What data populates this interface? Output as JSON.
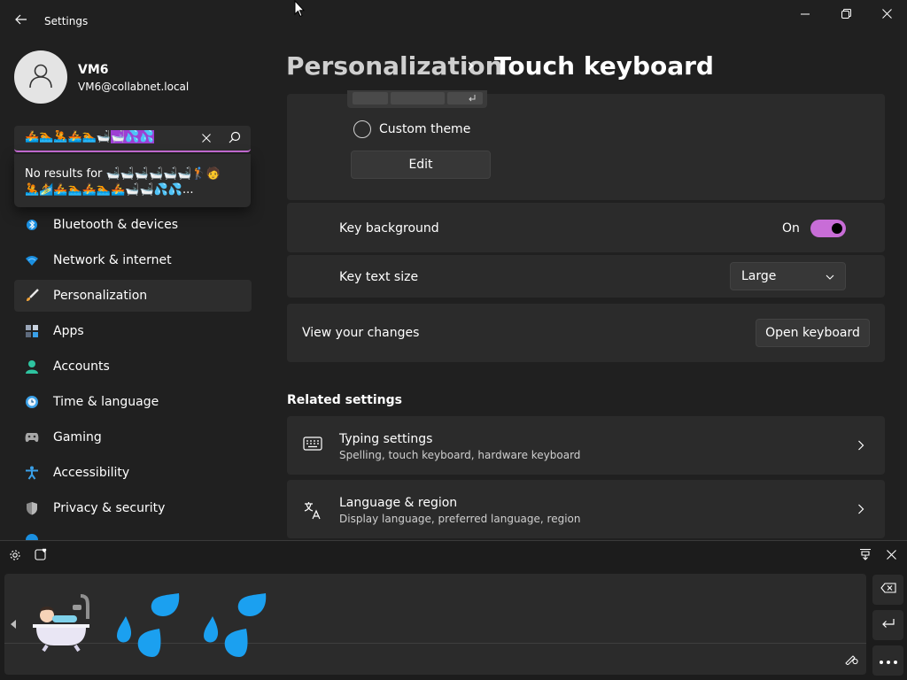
{
  "window": {
    "title": "Settings",
    "controls": {
      "minimize": "minimize",
      "maximize": "maximize",
      "close": "close"
    }
  },
  "profile": {
    "name": "VM6",
    "email": "VM6@collabnet.local"
  },
  "search": {
    "query_plain": "🚣🏊🤽🚣🏊🛁",
    "query_highlight": "🛁💦💦",
    "no_results_line1": "No results for 🛁🛁🛁🛁🛁🛁🏌️🧑",
    "no_results_line2": "🤽🏄🚣🏊🚣🏊🚣🛁🛁💦💦..."
  },
  "sidebar": {
    "items": [
      {
        "label": "Bluetooth & devices",
        "icon": "bluetooth-icon",
        "selected": false
      },
      {
        "label": "Network & internet",
        "icon": "wifi-icon",
        "selected": false
      },
      {
        "label": "Personalization",
        "icon": "brush-icon",
        "selected": true
      },
      {
        "label": "Apps",
        "icon": "apps-icon",
        "selected": false
      },
      {
        "label": "Accounts",
        "icon": "person-icon",
        "selected": false
      },
      {
        "label": "Time & language",
        "icon": "clock-globe-icon",
        "selected": false
      },
      {
        "label": "Gaming",
        "icon": "controller-icon",
        "selected": false
      },
      {
        "label": "Accessibility",
        "icon": "accessibility-icon",
        "selected": false
      },
      {
        "label": "Privacy & security",
        "icon": "shield-icon",
        "selected": false
      }
    ]
  },
  "breadcrumb": {
    "parent": "Personalization",
    "separator": "›",
    "current": "Touch keyboard"
  },
  "theme": {
    "custom_theme_label": "Custom theme",
    "custom_theme_selected": false,
    "edit_label": "Edit"
  },
  "key_background": {
    "label": "Key background",
    "state_label": "On",
    "enabled": true
  },
  "key_text_size": {
    "label": "Key text size",
    "value": "Large"
  },
  "view_changes": {
    "label": "View your changes",
    "button_label": "Open keyboard"
  },
  "related": {
    "title": "Related settings",
    "items": [
      {
        "title": "Typing settings",
        "subtitle": "Spelling, touch keyboard, hardware keyboard",
        "icon": "keyboard-icon"
      },
      {
        "title": "Language & region",
        "subtitle": "Display language, preferred language, region",
        "icon": "language-icon"
      }
    ]
  },
  "touch_keyboard": {
    "candidates": [
      "🛀",
      "💦",
      "💦"
    ],
    "icons": {
      "settings": "gear-icon",
      "emoji_toggle": "emoji-heart-icon",
      "dock": "dock-icon",
      "close": "close-icon",
      "backspace": "backspace-icon",
      "enter": "enter-icon",
      "more": "more-icon",
      "handwriting": "pen-icon"
    }
  },
  "colors": {
    "accent": "#c86dd7",
    "background": "#202020",
    "card": "#2b2b2b"
  }
}
